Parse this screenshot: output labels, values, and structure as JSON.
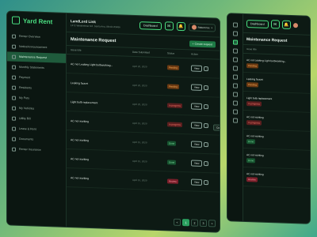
{
  "app": {
    "name": "Yard Rent"
  },
  "sidebar": {
    "items": [
      {
        "label": "Renter Overview",
        "icon": "grid-icon",
        "active": false
      },
      {
        "label": "Notice/Announcement",
        "icon": "bell-icon",
        "active": false
      },
      {
        "label": "Maintenance Request",
        "icon": "wrench-icon",
        "active": true
      },
      {
        "label": "Monthly Statements",
        "icon": "file-icon",
        "active": false
      },
      {
        "label": "Payment",
        "icon": "wallet-icon",
        "active": false
      },
      {
        "label": "Residents",
        "icon": "users-icon",
        "active": false
      },
      {
        "label": "My Pets",
        "icon": "paw-icon",
        "active": false
      },
      {
        "label": "My Vehicles",
        "icon": "car-icon",
        "active": false
      },
      {
        "label": "Utility Bill",
        "icon": "bolt-icon",
        "active": false
      },
      {
        "label": "Lease & Rent",
        "icon": "key-icon",
        "active": false
      },
      {
        "label": "Documents",
        "icon": "folder-icon",
        "active": false
      },
      {
        "label": "Renter Insurance",
        "icon": "shield-icon",
        "active": false
      }
    ]
  },
  "topbar": {
    "address_name": "LandLord Link",
    "address_line": "1472 Westheimer Rd. Santa Ana, Illinois 85486",
    "dashboard_label": "Dashboard",
    "profile_name": "Robert Fox"
  },
  "main": {
    "title": "Maintenance Request",
    "create_label": "+ Create request",
    "columns": [
      "Issue title",
      "Date Submitted",
      "Status",
      "Action"
    ],
    "rows": [
      {
        "title": "AC not Leaking Light bulbworking...",
        "date": "April 20, 2020",
        "status": "Pending",
        "status_kind": "pending"
      },
      {
        "title": "Leaking faucet",
        "date": "April 20, 2020",
        "status": "Pending",
        "status_kind": "pending"
      },
      {
        "title": "Light bulb replacement",
        "date": "April 25, 2020",
        "status": "In progress",
        "status_kind": "progress"
      },
      {
        "title": "AC not working",
        "date": "April 15, 2020",
        "status": "In progress",
        "status_kind": "progress"
      },
      {
        "title": "AC not working",
        "date": "April 15, 2020",
        "status": "Done",
        "status_kind": "done"
      },
      {
        "title": "AC not working",
        "date": "April 15, 2020",
        "status": "Done",
        "status_kind": "done"
      },
      {
        "title": "AC not working",
        "date": "April 15, 2020",
        "status": "Review",
        "status_kind": "review"
      }
    ],
    "view_label": "View",
    "cancel_label": "Cancel",
    "pages": [
      "<",
      "1",
      "2",
      "3",
      ">"
    ],
    "active_page": "1"
  },
  "side": {
    "title": "Maintenance Request",
    "column": "Issue title",
    "rows": [
      {
        "title": "AC not Leaking Light bulbworking...",
        "status": "Pending",
        "status_kind": "pending"
      },
      {
        "title": "Leaking faucet",
        "status": "Pending",
        "status_kind": "pending"
      },
      {
        "title": "Light bulb replacement",
        "status": "In progress",
        "status_kind": "progress"
      },
      {
        "title": "AC not working",
        "status": "In progress",
        "status_kind": "progress"
      },
      {
        "title": "AC not working",
        "status": "Done",
        "status_kind": "done"
      },
      {
        "title": "AC not working",
        "status": "Done",
        "status_kind": "done"
      },
      {
        "title": "AC not working",
        "status": "Review",
        "status_kind": "review"
      }
    ]
  },
  "colors": {
    "accent": "#4ade80",
    "bg": "#0d1a14"
  }
}
